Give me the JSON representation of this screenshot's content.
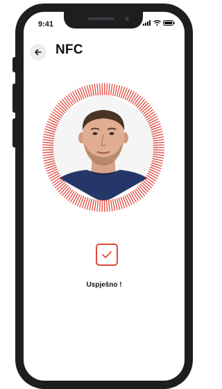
{
  "status_bar": {
    "time": "9:41",
    "icons": [
      "signal-icon",
      "wifi-icon",
      "battery-icon"
    ]
  },
  "header": {
    "back_icon": "arrow-left-icon",
    "title": "NFC"
  },
  "scan": {
    "ring_color": "#e2463c",
    "state_icon": "checkmark-icon"
  },
  "result": {
    "message": "Uspješno !",
    "accent": "#e2463c"
  }
}
